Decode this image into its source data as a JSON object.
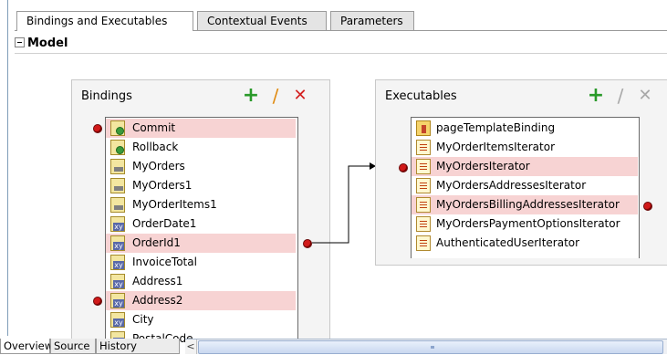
{
  "tabs": [
    {
      "label": "Bindings and Executables",
      "active": true
    },
    {
      "label": "Contextual Events",
      "active": false
    },
    {
      "label": "Parameters",
      "active": false
    }
  ],
  "model": {
    "title": "Model",
    "collapse_icon": "minus-box-icon"
  },
  "bindings": {
    "title": "Bindings",
    "tools": [
      {
        "name": "add-icon",
        "glyph": "+",
        "color": "#2a9a2a"
      },
      {
        "name": "edit-icon",
        "glyph": "/",
        "color": "#e08a10"
      },
      {
        "name": "delete-icon",
        "glyph": "✕",
        "color": "#d42020"
      }
    ],
    "items": [
      {
        "label": "Commit",
        "icon": "action-binding-icon",
        "highlighted": true,
        "left_marker": true
      },
      {
        "label": "Rollback",
        "icon": "action-binding-icon",
        "highlighted": false,
        "left_marker": false
      },
      {
        "label": "MyOrders",
        "icon": "tree-binding-icon",
        "highlighted": false,
        "left_marker": false
      },
      {
        "label": "MyOrders1",
        "icon": "tree-binding-icon",
        "highlighted": false,
        "left_marker": false
      },
      {
        "label": "MyOrderItems1",
        "icon": "tree-binding-icon",
        "highlighted": false,
        "left_marker": false
      },
      {
        "label": "OrderDate1",
        "icon": "attribute-binding-icon",
        "highlighted": false,
        "left_marker": false
      },
      {
        "label": "OrderId1",
        "icon": "attribute-binding-icon",
        "highlighted": true,
        "left_marker": false,
        "right_marker": true
      },
      {
        "label": "InvoiceTotal",
        "icon": "attribute-binding-icon",
        "highlighted": false,
        "left_marker": false
      },
      {
        "label": "Address1",
        "icon": "attribute-binding-icon",
        "highlighted": false,
        "left_marker": false
      },
      {
        "label": "Address2",
        "icon": "attribute-binding-icon",
        "highlighted": true,
        "left_marker": true
      },
      {
        "label": "City",
        "icon": "attribute-binding-icon",
        "highlighted": false,
        "left_marker": false
      },
      {
        "label": "PostalCode",
        "icon": "attribute-binding-icon",
        "highlighted": false,
        "left_marker": false
      }
    ]
  },
  "executables": {
    "title": "Executables",
    "tools": [
      {
        "name": "add-icon",
        "glyph": "+",
        "color": "#2a9a2a"
      },
      {
        "name": "edit-icon",
        "glyph": "/",
        "color": "#a8a8a8"
      },
      {
        "name": "delete-icon",
        "glyph": "✕",
        "color": "#a8a8a8"
      }
    ],
    "items": [
      {
        "label": "pageTemplateBinding",
        "icon": "page-template-icon",
        "highlighted": false
      },
      {
        "label": "MyOrderItemsIterator",
        "icon": "iterator-icon",
        "highlighted": false
      },
      {
        "label": "MyOrdersIterator",
        "icon": "iterator-icon",
        "highlighted": true,
        "left_marker": true
      },
      {
        "label": "MyOrdersAddressesIterator",
        "icon": "iterator-icon",
        "highlighted": false
      },
      {
        "label": "MyOrdersBillingAddressesIterator",
        "icon": "iterator-icon",
        "highlighted": true,
        "right_marker": true
      },
      {
        "label": "MyOrdersPaymentOptionsIterator",
        "icon": "iterator-icon",
        "highlighted": false
      },
      {
        "label": "AuthenticatedUserIterator",
        "icon": "iterator-icon",
        "highlighted": false
      }
    ]
  },
  "bottom_tabs": [
    {
      "label": "Overview",
      "active": true
    },
    {
      "label": "Source",
      "active": false
    },
    {
      "label": "History",
      "active": false
    }
  ],
  "scrollbar": {
    "left_arrow": "<"
  },
  "colors": {
    "highlight": "#f7d3d3",
    "marker": "#d11a1a",
    "tab_border": "#9a9a9a"
  }
}
